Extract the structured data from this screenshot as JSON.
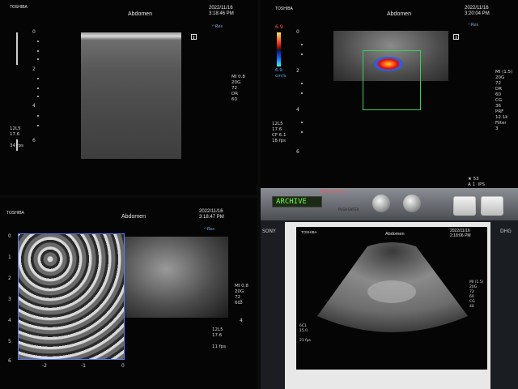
{
  "panels": {
    "top_left": {
      "brand": "TOSHIBA",
      "title": "Abdomen",
      "date": "2022/11/16",
      "time": "3:18:46 PM",
      "right_params": "MI 0.8\n20G\n72\nDR\n60",
      "left_params": "12L5\n17.6\n\n34 fps",
      "depth_ticks": [
        "0",
        "2",
        "4",
        "6"
      ]
    },
    "top_right": {
      "brand": "TOSHIBA",
      "title": "Abdomen",
      "date": "2022/11/16",
      "time": "3:20:04 PM",
      "color_scale_top": "6.9",
      "color_scale_bottom": "6.9\ncm/s",
      "right_params": "MI (1.5)\n20G\n72\nDR\n60\nCG\n36\nPRF\n12.1k\nFilter\n3",
      "left_params": "12L5\n17.6\nCF 6.1\n18 fps",
      "depth_ticks": [
        "0",
        "2",
        "4",
        "6"
      ],
      "bottom_right": "★ 53\nA 1  IPS"
    },
    "bottom_left": {
      "brand": "TOSHIBA",
      "title": "Abdomen",
      "date": "2022/11/16",
      "time": "3:18:47 PM",
      "right_params": "MI 0.8\n20G\n72\n60",
      "left_params": "12L5\n17.6\n\n11 fps",
      "depth_ticks": [
        "0",
        "1",
        "2",
        "3",
        "4",
        "5",
        "6"
      ],
      "x_ticks": [
        "-2",
        "-1",
        "0"
      ],
      "right_ticks": [
        "3",
        "4"
      ]
    },
    "bottom_right": {
      "brand": "TOSHIBA",
      "title": "Abdomen",
      "date": "2022/11/16",
      "time": "2:18:06 PM",
      "right_params": "MI (1.5)\n20G\n72\n60\nCG\n40",
      "left_params": "6C1\n15.0\n\n21 fps",
      "lcd_text": "ARCHIVE",
      "led_text": "HDD I/O Fan",
      "push_enter": "PUSH ENTER",
      "brand_strip": "SONY",
      "logo_right": "DHG"
    }
  }
}
